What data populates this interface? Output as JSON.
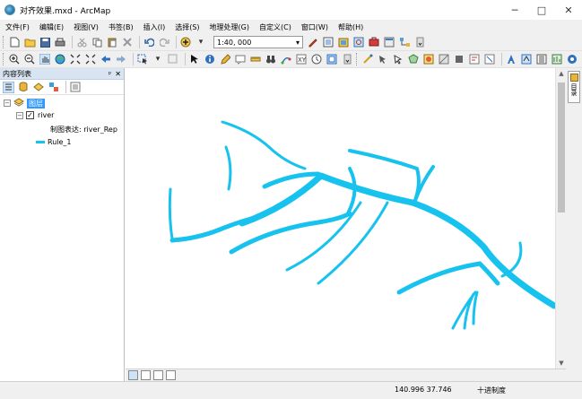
{
  "window": {
    "title": "对齐效果.mxd - ArcMap",
    "minimize": "─",
    "maximize": "□",
    "close": "✕"
  },
  "menu": [
    "文件(F)",
    "编辑(E)",
    "视图(V)",
    "书签(B)",
    "插入(I)",
    "选择(S)",
    "地理处理(G)",
    "自定义(C)",
    "窗口(W)",
    "帮助(H)"
  ],
  "toolbar": {
    "scale_value": "1:40, 000",
    "dropdown_arrow": "▾"
  },
  "toc": {
    "title": "内容列表",
    "pin": "ᵖ",
    "close": "✕",
    "layers_label": "图层",
    "layer_name": "river",
    "layer_checked": "✓",
    "representation_label": "制图表达: river_Rep",
    "rule_label": "Rule_1",
    "expander_collapsed": "−"
  },
  "right_dock": {
    "tab_label": "目录"
  },
  "status": {
    "coords": "140.996  37.746",
    "units": "十进制度"
  },
  "colors": {
    "river": "#17c3ee",
    "toc_header": "#d9e4f2",
    "selection": "#3399ff"
  }
}
